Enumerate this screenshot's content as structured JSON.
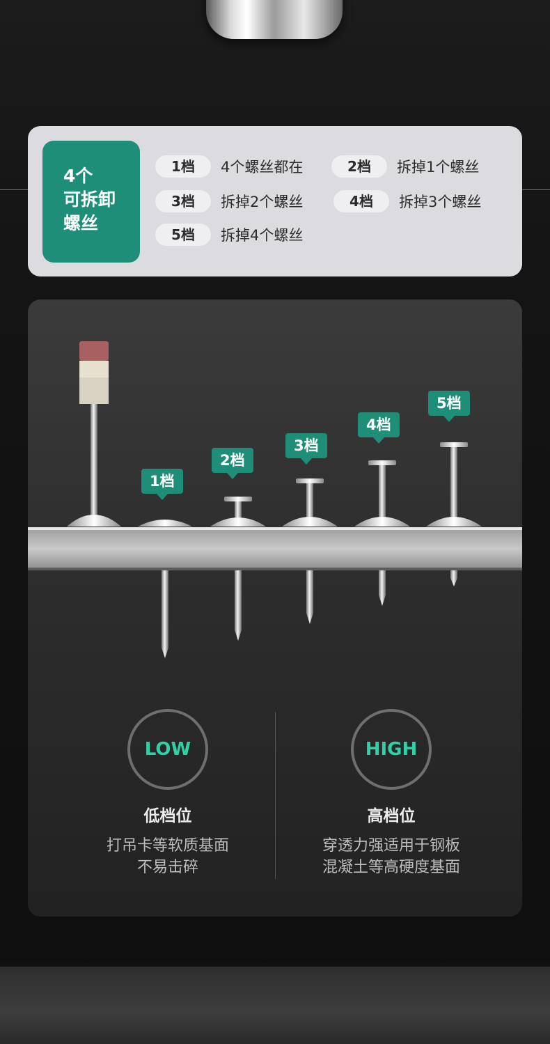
{
  "info_card": {
    "badge_lines": [
      "4个",
      "可拆卸",
      "螺丝"
    ],
    "gears": [
      {
        "label": "1档",
        "desc": "4个螺丝都在"
      },
      {
        "label": "2档",
        "desc": "拆掉1个螺丝"
      },
      {
        "label": "3档",
        "desc": "拆掉2个螺丝"
      },
      {
        "label": "4档",
        "desc": "拆掉3个螺丝"
      },
      {
        "label": "5档",
        "desc": "拆掉4个螺丝"
      }
    ]
  },
  "diagram": {
    "tags": [
      "1档",
      "2档",
      "3档",
      "4档",
      "5档"
    ]
  },
  "levels": {
    "low": {
      "badge": "LOW",
      "title": "低档位",
      "desc_lines": [
        "打吊卡等软质基面",
        "不易击碎"
      ]
    },
    "high": {
      "badge": "HIGH",
      "title": "高档位",
      "desc_lines": [
        "穿透力强适用于钢板",
        "混凝土等高硬度基面"
      ]
    }
  },
  "colors": {
    "accent": "#1f8e78",
    "accent_text": "#2fd2a6",
    "card_bg": "#dcdbe0"
  }
}
